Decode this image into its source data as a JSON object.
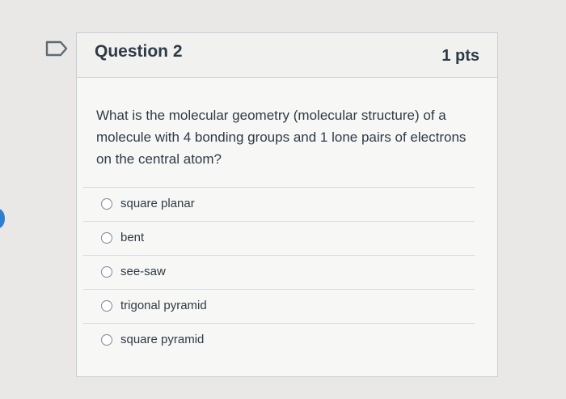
{
  "question": {
    "title": "Question 2",
    "points": "1 pts",
    "text": "What is the molecular geometry (molecular structure) of a molecule with 4 bonding groups and 1 lone pairs of electrons on the central atom?"
  },
  "answers": [
    {
      "label": "square planar"
    },
    {
      "label": "bent"
    },
    {
      "label": "see-saw"
    },
    {
      "label": "trigonal pyramid"
    },
    {
      "label": "square pyramid"
    }
  ],
  "icons": {
    "flag": "flag-outline-icon"
  },
  "colors": {
    "text": "#2d3b45",
    "border": "#c7cdd1",
    "accent": "#2d7fd0"
  }
}
